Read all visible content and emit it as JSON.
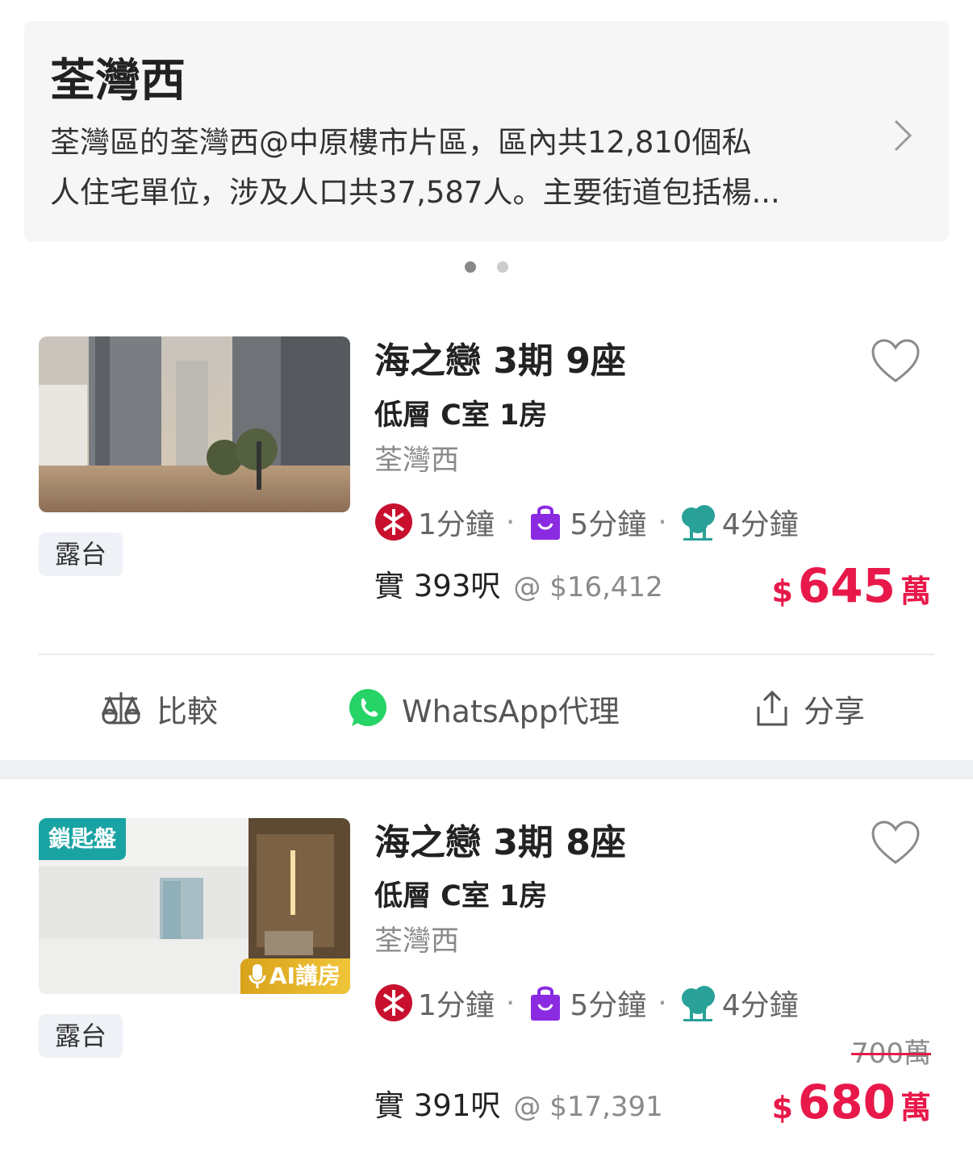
{
  "district": {
    "title": "荃灣西",
    "desc_line1": "荃灣區的荃灣西@中原樓市片區，區內共12,810個私",
    "desc_line2": "人住宅單位，涉及人口共37,587人。主要街道包括楊..."
  },
  "carousel": {
    "active_index": 0,
    "count": 2
  },
  "listings": [
    {
      "title": "海之戀 3期 9座",
      "subtitle": "低層 C室 1房",
      "area": "荃灣西",
      "tag": "露台",
      "mtr_time": "1分鐘",
      "mall_time": "5分鐘",
      "park_time": "4分鐘",
      "size": "實 393呎",
      "unit_price": "@ $16,412",
      "price_currency": "$",
      "price": "645",
      "price_unit": "萬",
      "badges": []
    },
    {
      "title": "海之戀 3期 8座",
      "subtitle": "低層 C室 1房",
      "area": "荃灣西",
      "tag": "露台",
      "mtr_time": "1分鐘",
      "mall_time": "5分鐘",
      "park_time": "4分鐘",
      "size": "實 391呎",
      "unit_price": "@ $17,391",
      "original_price": "700萬",
      "price_currency": "$",
      "price": "680",
      "price_unit": "萬",
      "badges": [
        "鎖匙盤",
        "AI講房"
      ]
    }
  ],
  "actions": {
    "compare": "比較",
    "whatsapp": "WhatsApp代理",
    "share": "分享"
  },
  "colors": {
    "price_red": "#e8194a",
    "mtr_red": "#c8102e",
    "mall_purple": "#8a2be2",
    "park_teal": "#2aa198",
    "whatsapp_green": "#25d366",
    "key_badge_teal": "#1aa3a3",
    "ai_badge_gold": "#e0aa22"
  },
  "icons": {
    "mtr": "mtr-icon",
    "mall": "shopping-bag-icon",
    "park": "tree-icon",
    "favorite": "heart-icon",
    "compare": "scale-icon",
    "whatsapp": "whatsapp-icon",
    "share": "share-icon",
    "more": "chevron-right-icon",
    "ai": "microphone-icon"
  }
}
